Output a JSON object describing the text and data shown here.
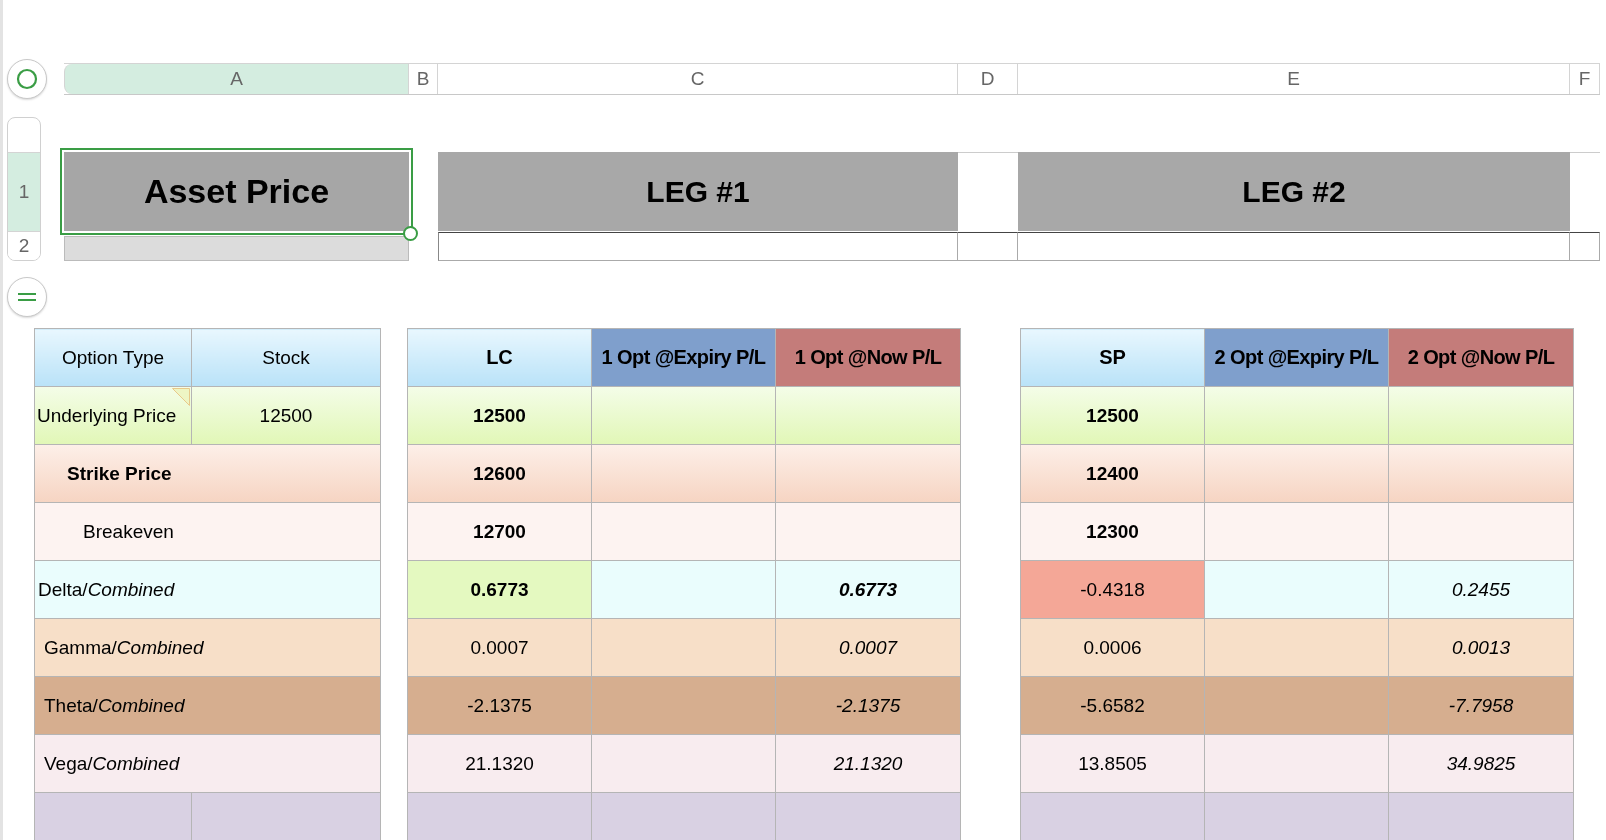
{
  "column_headers": [
    {
      "label": "A",
      "selected": true
    },
    {
      "label": "B",
      "selected": false
    },
    {
      "label": "C",
      "selected": false
    },
    {
      "label": "D",
      "selected": false
    },
    {
      "label": "E",
      "selected": false
    },
    {
      "label": "F",
      "selected": false
    }
  ],
  "row_headers": [
    {
      "label": "1",
      "selected": true
    },
    {
      "label": "2",
      "selected": false
    }
  ],
  "title_row": {
    "asset": {
      "text": "Asset Price",
      "selected": true
    },
    "legs": [
      "LEG #1",
      "LEG #2"
    ]
  },
  "summary_table": {
    "columns": [
      "Option Type",
      "Stock"
    ],
    "rows": [
      {
        "label": "Underlying Price",
        "value": "12500",
        "comment": true
      },
      {
        "label": "Strike Price",
        "comment": false
      },
      {
        "label": "Breakeven",
        "comment": false
      },
      {
        "label": "Delta/*Combined*",
        "comment": false
      },
      {
        "label": "Gamma/*Combined*",
        "comment": false
      },
      {
        "label": "Theta/*Combined*",
        "comment": false
      },
      {
        "label": "Vega/*Combined*",
        "comment": false
      }
    ]
  },
  "leg_tables": [
    {
      "columns": [
        "LC",
        "1 Opt @Expiry P/L",
        "1 Opt @Now P/L"
      ],
      "rows": [
        {
          "value": "12500",
          "bold": true
        },
        {
          "value": "12600",
          "bold": true
        },
        {
          "value": "12700",
          "bold": true
        },
        {
          "value": "0.6773",
          "bold": true,
          "now": "0.6773",
          "color": "#e4f9c0"
        },
        {
          "value": "0.0007",
          "bold": false,
          "now": "0.0007"
        },
        {
          "value": "-2.1375",
          "bold": false,
          "now": "-2.1375"
        },
        {
          "value": "21.1320",
          "bold": false,
          "now": "21.1320"
        }
      ]
    },
    {
      "columns": [
        "SP",
        "2 Opt @Expiry P/L",
        "2 Opt @Now P/L"
      ],
      "rows": [
        {
          "value": "12500",
          "bold": true
        },
        {
          "value": "12400",
          "bold": true
        },
        {
          "value": "12300",
          "bold": true
        },
        {
          "value": "-0.4318",
          "bold": false,
          "now": "0.2455",
          "color": "#f4a797"
        },
        {
          "value": "0.0006",
          "bold": false,
          "now": "0.0013"
        },
        {
          "value": "-5.6582",
          "bold": false,
          "now": "-7.7958"
        },
        {
          "value": "13.8505",
          "bold": false,
          "now": "34.9825"
        }
      ]
    }
  ]
}
